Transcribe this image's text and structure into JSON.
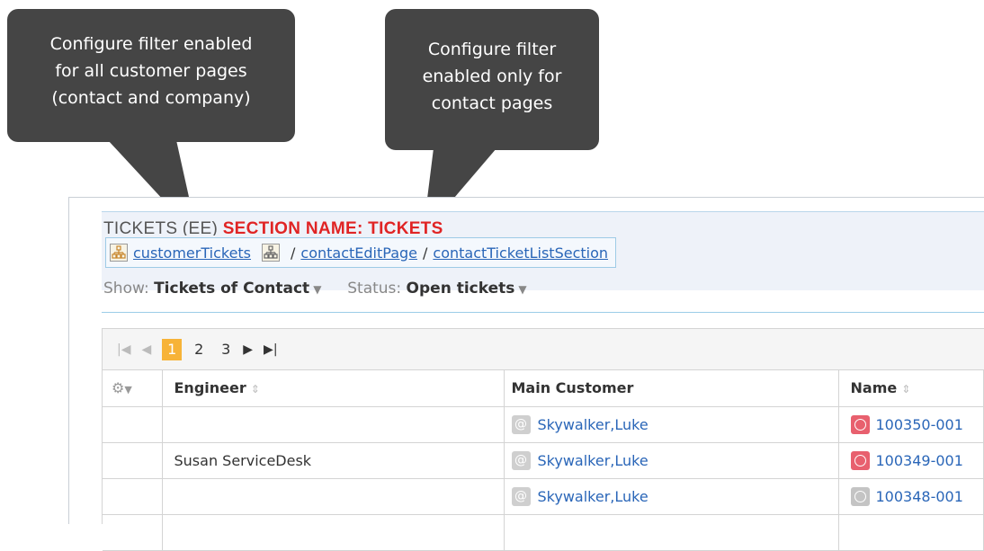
{
  "callouts": {
    "left": {
      "lines": [
        "Configure filter enabled",
        "for all customer pages",
        "(contact and company)"
      ]
    },
    "right": {
      "lines": [
        "Configure filter",
        "enabled only for",
        "contact pages"
      ]
    }
  },
  "section": {
    "title_prefix": "TICKETS (EE) ",
    "title_name": "SECTION NAME: TICKETS"
  },
  "breadcrumb": {
    "first": "customerTickets",
    "separator": "/",
    "second": "contactEditPage",
    "third": "contactTicketListSection"
  },
  "filters": {
    "show_label": "Show:",
    "show_value": "Tickets of Contact",
    "status_label": "Status:",
    "status_value": "Open tickets"
  },
  "pager": {
    "pages": [
      "1",
      "2",
      "3"
    ],
    "current_page": "1"
  },
  "table": {
    "columns": {
      "engineer": "Engineer",
      "main_customer": "Main Customer",
      "name": "Name"
    },
    "rows": [
      {
        "engineer": "",
        "customer": "Skywalker,Luke",
        "name": "100350-001",
        "status_color": "#e8606e"
      },
      {
        "engineer": "Susan ServiceDesk",
        "customer": "Skywalker,Luke",
        "name": "100349-001",
        "status_color": "#e8606e"
      },
      {
        "engineer": "",
        "customer": "Skywalker,Luke",
        "name": "100348-001",
        "status_color": "#c4c4c4"
      }
    ]
  },
  "colors": {
    "callout_bg": "#454545",
    "section_red": "#e02424",
    "link_blue": "#2a66b8",
    "active_page": "#f7b338"
  }
}
